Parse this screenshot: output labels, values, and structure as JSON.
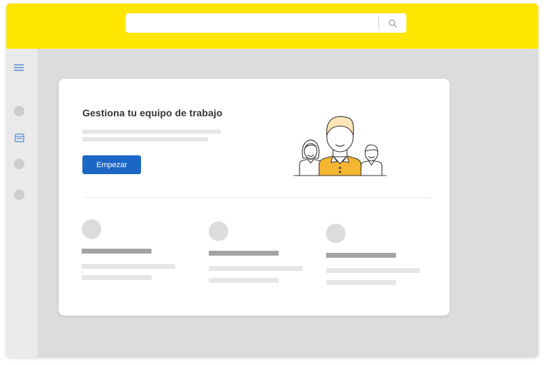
{
  "search": {
    "value": "",
    "placeholder": "",
    "icon": "search-icon"
  },
  "sidebar": {
    "menu_icon": "hamburger-menu-icon",
    "items": [
      {
        "type": "placeholder-dot"
      },
      {
        "type": "icon",
        "icon": "calendar-icon",
        "active": true
      },
      {
        "type": "placeholder-dot"
      },
      {
        "type": "placeholder-dot"
      }
    ]
  },
  "card": {
    "title": "Gestiona tu equipo de trabajo",
    "cta_label": "Empezar",
    "illustration": "team-people-icon"
  },
  "colors": {
    "topbar": "#ffe600",
    "accent": "#1e66c6",
    "illustration_highlight": "#f5b731",
    "sidebar_icon": "#3a7bd5"
  }
}
